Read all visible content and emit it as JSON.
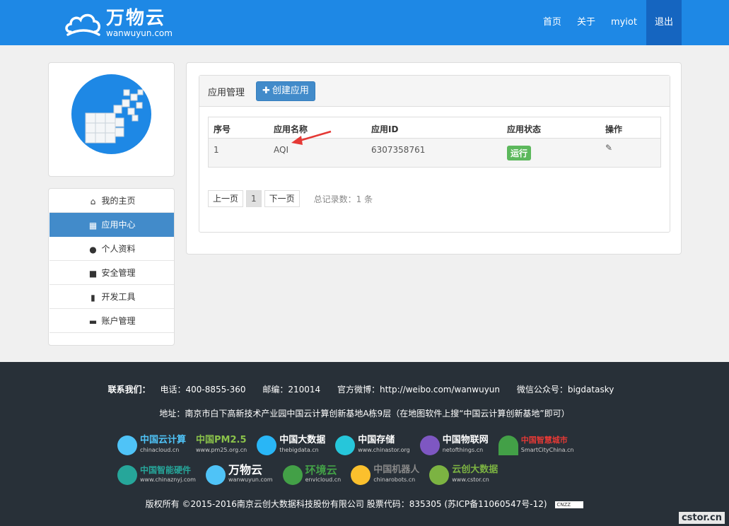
{
  "header": {
    "logo_cn": "万物云",
    "logo_en": "wanwuyun.com",
    "nav": [
      "首页",
      "关于",
      "myiot",
      "退出"
    ]
  },
  "sidebar": {
    "items": [
      {
        "label": "我的主页",
        "icon": "home-icon"
      },
      {
        "label": "应用中心",
        "icon": "grid-icon"
      },
      {
        "label": "个人资料",
        "icon": "user-icon"
      },
      {
        "label": "安全管理",
        "icon": "lock-icon"
      },
      {
        "label": "开发工具",
        "icon": "book-icon"
      },
      {
        "label": "账户管理",
        "icon": "card-icon"
      }
    ],
    "active_index": 1
  },
  "main": {
    "panel_title": "应用管理",
    "create_button": "创建应用",
    "table": {
      "columns": [
        "序号",
        "应用名称",
        "应用ID",
        "应用状态",
        "操作"
      ],
      "rows": [
        {
          "index": "1",
          "name": "AQI",
          "app_id": "6307358761",
          "status": "运行"
        }
      ]
    },
    "pager": {
      "prev": "上一页",
      "current": "1",
      "next": "下一页",
      "total": "总记录数：1 条"
    }
  },
  "footer": {
    "contact_label": "联系我们：",
    "phone": "电话：400-8855-360",
    "postcode": "邮编：210014",
    "weibo": "官方微博：http://weibo.com/wanwuyun",
    "wechat": "微信公众号：bigdatasky",
    "address": "地址：南京市白下高新技术产业园中国云计算创新基地A栋9层（在地图软件上搜“中国云计算创新基地”即可）",
    "partners_row1": [
      {
        "name": "中国云计算",
        "sub": "chinacloud.cn",
        "color": "#4fc3f7"
      },
      {
        "name": "中国PM2.5",
        "sub": "www.pm25.org.cn",
        "color": "#8bc34a"
      },
      {
        "name": "中国大数据",
        "sub": "thebigdata.cn",
        "color": "#29b6f6"
      },
      {
        "name": "中国存储",
        "sub": "www.chinastor.org",
        "color": "#26c6da"
      },
      {
        "name": "中国物联网",
        "sub": "netofthings.cn",
        "color": "#7e57c2"
      },
      {
        "name": "中国智慧城市",
        "sub": "SmartCityChina.cn",
        "color": "#e53935"
      }
    ],
    "partners_row2": [
      {
        "name": "中国智能硬件",
        "sub": "www.chinaznyj.com",
        "color": "#26a69a"
      },
      {
        "name": "万物云",
        "sub": "wanwuyun.com",
        "color": "#4fc3f7"
      },
      {
        "name": "环境云",
        "sub": "envicloud.cn",
        "color": "#43a047"
      },
      {
        "name": "中国机器人",
        "sub": "chinarobots.cn",
        "color": "#fbc02d"
      },
      {
        "name": "云创大数据",
        "sub": "www.cstor.cn",
        "color": "#7cb342"
      }
    ],
    "copyright": "版权所有 ©2015-2016南京云创大数据科技股份有限公司 股票代码：835305 (苏ICP备11060547号-12)",
    "cnzz": "CNZZ",
    "watermark": "cstor.cn"
  }
}
